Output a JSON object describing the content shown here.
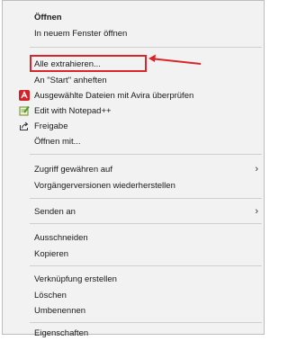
{
  "menu": {
    "items": [
      {
        "id": "open",
        "label": "Öffnen",
        "bold": true
      },
      {
        "id": "open-new-window",
        "label": "In neuem Fenster öffnen"
      },
      {
        "id": "extract-all",
        "label": "Alle extrahieren..."
      },
      {
        "id": "pin-start",
        "label": "An \"Start\" anheften"
      },
      {
        "id": "avira-scan",
        "label": "Ausgewählte Dateien mit Avira überprüfen",
        "icon": "avira-icon"
      },
      {
        "id": "edit-notepad",
        "label": "Edit with Notepad++",
        "icon": "notepadpp-icon"
      },
      {
        "id": "share",
        "label": "Freigabe",
        "icon": "share-icon"
      },
      {
        "id": "open-with",
        "label": "Öffnen mit..."
      },
      {
        "id": "grant-access",
        "label": "Zugriff gewähren auf",
        "submenu": true
      },
      {
        "id": "restore-versions",
        "label": "Vorgängerversionen wiederherstellen"
      },
      {
        "id": "send-to",
        "label": "Senden an",
        "submenu": true
      },
      {
        "id": "cut",
        "label": "Ausschneiden"
      },
      {
        "id": "copy",
        "label": "Kopieren"
      },
      {
        "id": "create-shortcut",
        "label": "Verknüpfung erstellen"
      },
      {
        "id": "delete",
        "label": "Löschen"
      },
      {
        "id": "rename",
        "label": "Umbenennen"
      },
      {
        "id": "properties",
        "label": "Eigenschaften"
      }
    ],
    "submenu_glyph": "›"
  },
  "colors": {
    "highlight_annotation": "#d8262a",
    "avira_red": "#d62027",
    "menu_bg": "#f2f2f2"
  }
}
